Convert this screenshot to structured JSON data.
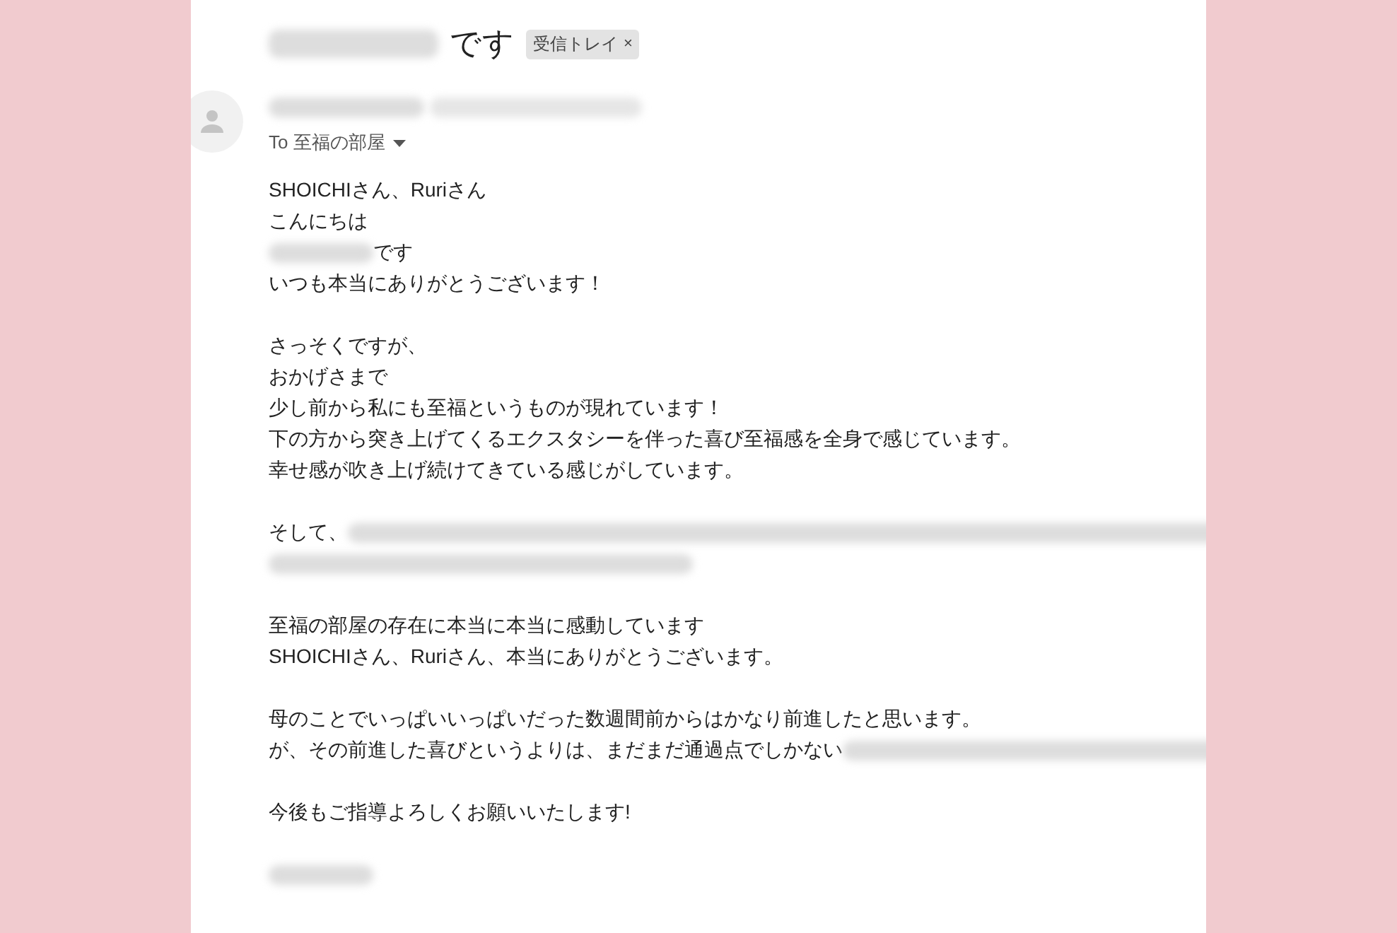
{
  "subject": {
    "segments": [
      {
        "kind": "name"
      },
      {
        "kind": "text",
        "text": "です"
      }
    ],
    "label": {
      "text": "受信トレイ",
      "close": "×"
    }
  },
  "sender": {
    "segments": [
      {
        "kind": "name"
      },
      {
        "kind": "long"
      }
    ],
    "to": "To 至福の部屋"
  },
  "body": [
    {
      "segments": [
        {
          "kind": "text",
          "text": "SHOICHIさん、Ruriさん"
        }
      ]
    },
    {
      "segments": [
        {
          "kind": "text",
          "text": "こんにちは"
        }
      ]
    },
    {
      "segments": [
        {
          "kind": "name"
        },
        {
          "kind": "text",
          "text": "です"
        }
      ]
    },
    {
      "segments": [
        {
          "kind": "text",
          "text": "いつも本当にありがとうございます！"
        }
      ]
    },
    {
      "segments": [
        {
          "kind": "blank"
        }
      ]
    },
    {
      "segments": [
        {
          "kind": "text",
          "text": "さっそくですが、"
        }
      ]
    },
    {
      "segments": [
        {
          "kind": "text",
          "text": "おかげさまで"
        }
      ]
    },
    {
      "segments": [
        {
          "kind": "text",
          "text": "少し前から私にも至福というものが現れています！"
        }
      ]
    },
    {
      "segments": [
        {
          "kind": "text",
          "text": "下の方から突き上げてくるエクスタシーを伴った喜び至福感を全身で感じています。"
        }
      ]
    },
    {
      "segments": [
        {
          "kind": "text",
          "text": "幸せ感が吹き上げ続けてきている感じがしています。"
        }
      ]
    },
    {
      "segments": [
        {
          "kind": "blank"
        }
      ]
    },
    {
      "segments": [
        {
          "kind": "text",
          "text": "そして、"
        },
        {
          "kind": "rest"
        }
      ]
    },
    {
      "segments": [
        {
          "kind": "long"
        }
      ]
    },
    {
      "segments": [
        {
          "kind": "blank"
        }
      ]
    },
    {
      "segments": [
        {
          "kind": "text",
          "text": "至福の部屋の存在に本当に本当に感動しています"
        }
      ]
    },
    {
      "segments": [
        {
          "kind": "text",
          "text": "SHOICHIさん、Ruriさん、本当にありがとうございます。"
        }
      ]
    },
    {
      "segments": [
        {
          "kind": "blank"
        }
      ]
    },
    {
      "segments": [
        {
          "kind": "text",
          "text": "母のことでいっぱいいっぱいだった数週間前からはかなり前進したと思います。"
        }
      ]
    },
    {
      "segments": [
        {
          "kind": "text",
          "text": "が、その前進した喜びというよりは、まだまだ通過点でしかない"
        },
        {
          "kind": "rest"
        }
      ]
    },
    {
      "segments": [
        {
          "kind": "blank"
        }
      ]
    },
    {
      "segments": [
        {
          "kind": "text",
          "text": "今後もご指導よろしくお願いいたします!"
        }
      ]
    },
    {
      "segments": [
        {
          "kind": "blank"
        }
      ]
    },
    {
      "segments": [
        {
          "kind": "name"
        }
      ]
    }
  ]
}
